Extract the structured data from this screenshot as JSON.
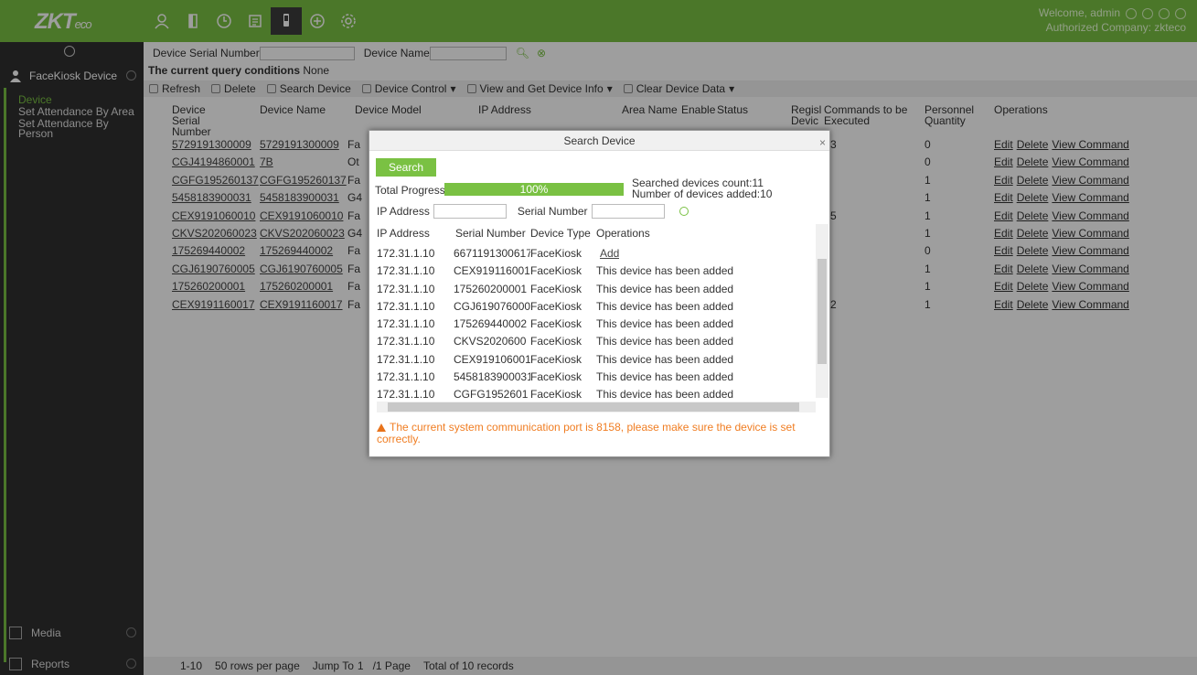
{
  "header": {
    "logo_main": "ZKT",
    "logo_eco": "eco",
    "welcome": "Welcome, admin",
    "company": "Authorized Company: zkteco",
    "icons": [
      "personnel-icon",
      "device-icon",
      "attendance-icon",
      "report-icon",
      "facekiosk-icon",
      "add-icon",
      "settings-icon"
    ]
  },
  "sidebar": {
    "module": "FaceKiosk Device",
    "items": [
      {
        "label": "Device"
      },
      {
        "label": "Set Attendance By Area"
      },
      {
        "label": "Set Attendance By Person"
      }
    ],
    "bottom": [
      {
        "label": "Media"
      },
      {
        "label": "Reports"
      }
    ]
  },
  "query": {
    "serial_label": "Device Serial Number",
    "name_label": "Device Name",
    "conditions_label": "The current query conditions",
    "conditions_value": "None"
  },
  "toolbar": {
    "refresh": "Refresh",
    "delete": "Delete",
    "search_device": "Search Device",
    "device_control": "Device Control",
    "view_info": "View and Get Device Info",
    "clear_data": "Clear Device Data"
  },
  "table": {
    "headers": {
      "serial": "Device Serial Number",
      "name": "Device Name",
      "model": "Device Model",
      "ip": "IP Address",
      "area": "Area Name",
      "enable": "Enable",
      "status": "Status",
      "regis": "Regisl Devic",
      "commands": "Commands to be Executed",
      "personnel": "Personnel Quantity",
      "operations": "Operations"
    },
    "rows": [
      {
        "serial": "5729191300009",
        "name": "5729191300009",
        "model": "Fa",
        "commands": "3",
        "qty": "0"
      },
      {
        "serial": "CGJ4194860001",
        "name": "7B",
        "model": "Ot",
        "commands": "",
        "qty": "0"
      },
      {
        "serial": "CGFG195260137",
        "name": "CGFG195260137",
        "model": "Fa",
        "commands": "",
        "qty": "1"
      },
      {
        "serial": "5458183900031",
        "name": "5458183900031",
        "model": "G4",
        "commands": "",
        "qty": "1"
      },
      {
        "serial": "CEX9191060010",
        "name": "CEX9191060010",
        "model": "Fa",
        "commands": "5",
        "qty": "1"
      },
      {
        "serial": "CKVS202060023",
        "name": "CKVS202060023",
        "model": "G4",
        "commands": "",
        "qty": "1"
      },
      {
        "serial": "175269440002",
        "name": "175269440002",
        "model": "Fa",
        "commands": "",
        "qty": "0"
      },
      {
        "serial": "CGJ6190760005",
        "name": "CGJ6190760005",
        "model": "Fa",
        "commands": "",
        "qty": "1"
      },
      {
        "serial": "175260200001",
        "name": "175260200001",
        "model": "Fa",
        "commands": "",
        "qty": "1"
      },
      {
        "serial": "CEX9191160017",
        "name": "CEX9191160017",
        "model": "Fa",
        "commands": "2",
        "qty": "1"
      }
    ],
    "op_edit": "Edit",
    "op_delete": "Delete",
    "op_view": "View Command"
  },
  "pager": {
    "range": "1-10",
    "rows_per_page": "50 rows per page",
    "jump_to": "Jump To",
    "page_value": "1",
    "page_total": "/1 Page",
    "total": "Total of 10 records"
  },
  "modal": {
    "title": "Search Device",
    "search_btn": "Search",
    "progress_label": "Total Progress",
    "progress_text": "100%",
    "progress_fraction": 1.0,
    "searched_count": "Searched devices count:11",
    "added_count": "Number of devices added:10",
    "ip_label": "IP Address",
    "serial_label": "Serial Number",
    "headers": {
      "ip": "IP Address",
      "serial": "Serial Number",
      "type": "Device Type",
      "ops": "Operations"
    },
    "rows": [
      {
        "ip": "172.31.1.10",
        "serial": "6671191300617",
        "type": "FaceKiosk",
        "op": "Add"
      },
      {
        "ip": "172.31.1.10",
        "serial": "CEX919116001",
        "type": "FaceKiosk",
        "op": "This device has been added"
      },
      {
        "ip": "172.31.1.10",
        "serial": "175260200001",
        "type": "FaceKiosk",
        "op": "This device has been added"
      },
      {
        "ip": "172.31.1.10",
        "serial": "CGJ619076000",
        "type": "FaceKiosk",
        "op": "This device has been added"
      },
      {
        "ip": "172.31.1.10",
        "serial": "175269440002",
        "type": "FaceKiosk",
        "op": "This device has been added"
      },
      {
        "ip": "172.31.1.10",
        "serial": "CKVS2020600",
        "type": "FaceKiosk",
        "op": "This device has been added"
      },
      {
        "ip": "172.31.1.10",
        "serial": "CEX919106001",
        "type": "FaceKiosk",
        "op": "This device has been added"
      },
      {
        "ip": "172.31.1.10",
        "serial": "5458183900031",
        "type": "FaceKiosk",
        "op": "This device has been added"
      },
      {
        "ip": "172.31.1.10",
        "serial": "CGFG1952601",
        "type": "FaceKiosk",
        "op": "This device has been added"
      }
    ],
    "warning": "The current system communication port is 8158, please make sure the device is set correctly."
  }
}
